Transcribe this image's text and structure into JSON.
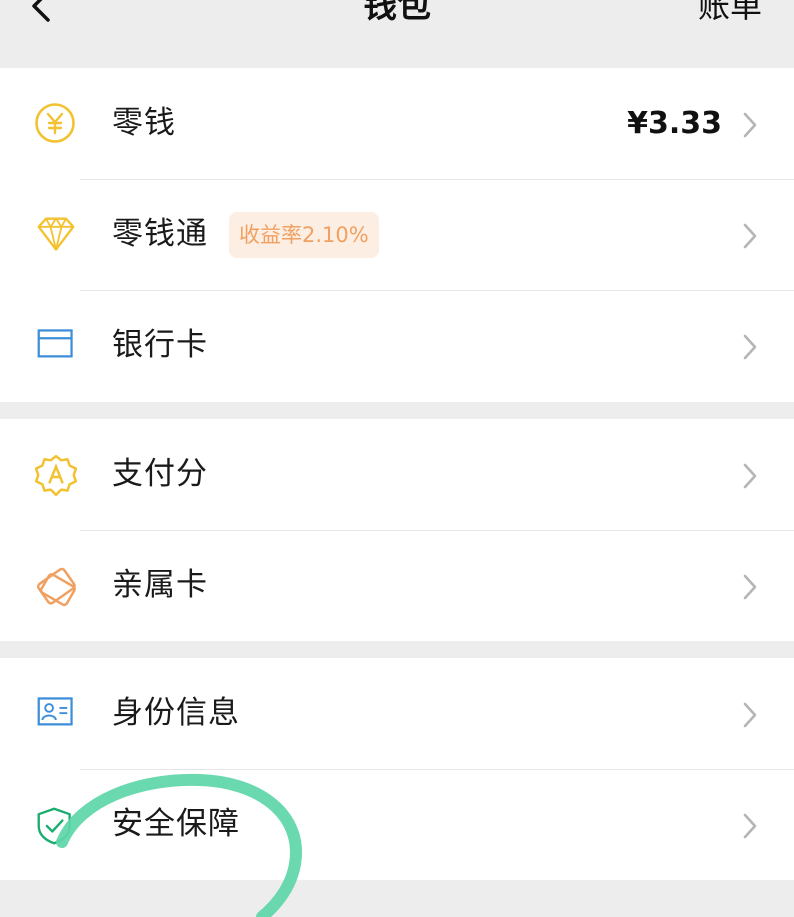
{
  "nav": {
    "title": "钱包",
    "bill_label": "账单"
  },
  "groups": [
    {
      "rows": [
        {
          "label": "零钱",
          "value": "¥3.33",
          "icon": "yuan-coin-icon"
        },
        {
          "label": "零钱通",
          "badge": "收益率2.10%",
          "icon": "diamond-icon"
        },
        {
          "label": "银行卡",
          "icon": "bank-card-icon"
        }
      ]
    },
    {
      "rows": [
        {
          "label": "支付分",
          "icon": "pay-score-badge-icon"
        },
        {
          "label": "亲属卡",
          "icon": "family-card-icon"
        }
      ]
    },
    {
      "rows": [
        {
          "label": "身份信息",
          "icon": "id-card-icon"
        },
        {
          "label": "安全保障",
          "icon": "shield-check-icon"
        }
      ]
    }
  ],
  "colors": {
    "background": "#ededed",
    "yellow_icon": "#f2c230",
    "blue_icon": "#3d8ed9",
    "orange_icon": "#f0a060",
    "green_icon": "#1aad6f",
    "badge_bg": "#fdeee3",
    "annotation_stroke": "#5ed6a8"
  }
}
